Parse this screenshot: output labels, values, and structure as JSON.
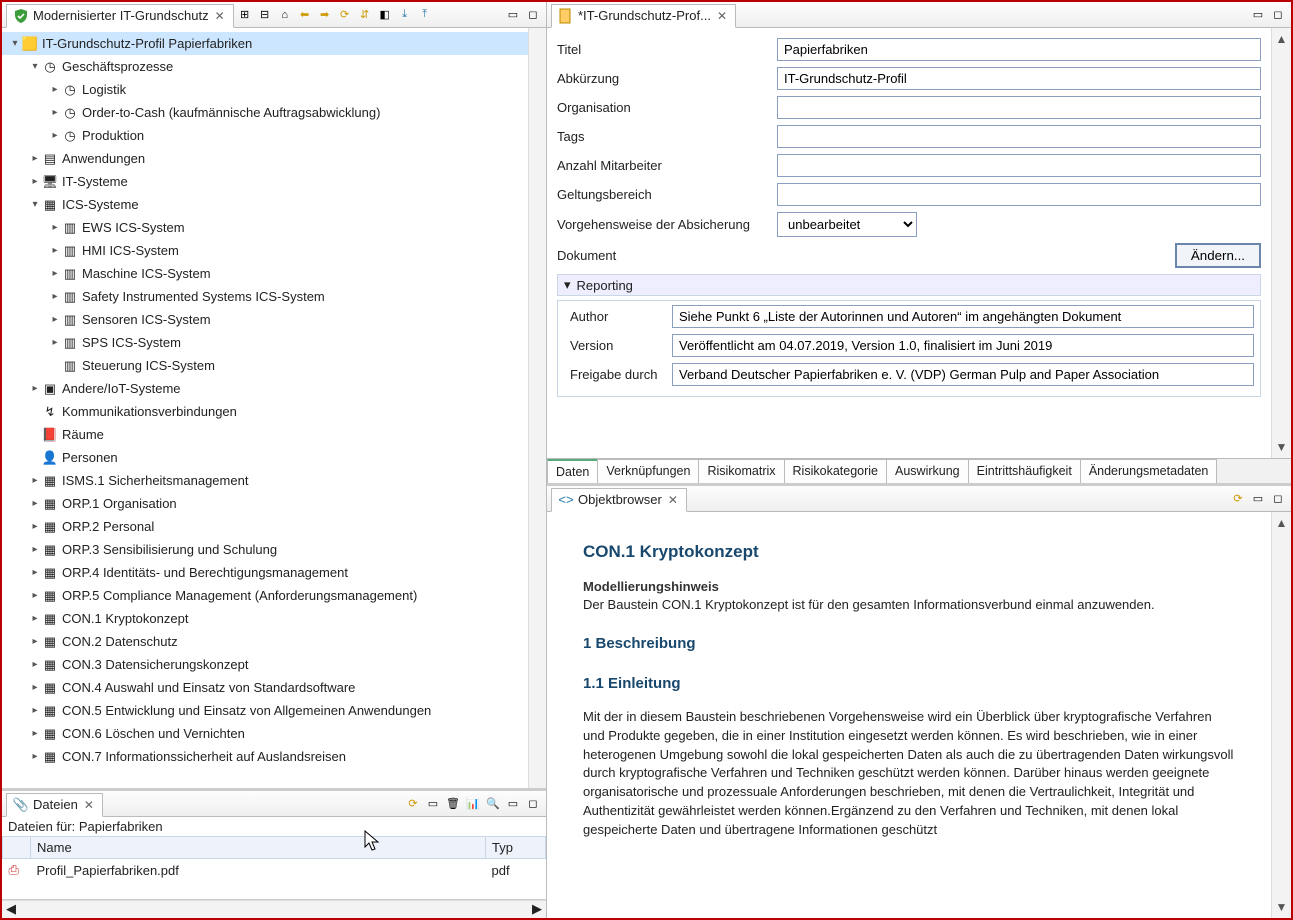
{
  "left_view": {
    "tab_title": "Modernisierter IT-Grundschutz",
    "toolbar_icons": [
      "expand-all",
      "collapse-all",
      "home",
      "back",
      "forward",
      "refresh",
      "link",
      "new",
      "import",
      "export"
    ]
  },
  "tree": {
    "root": "IT-Grundschutz-Profil  Papierfabriken",
    "items": [
      {
        "indent": 1,
        "exp": "down",
        "icon": "org",
        "label": "Geschäftsprozesse"
      },
      {
        "indent": 2,
        "exp": "right",
        "icon": "proc",
        "label": "Logistik"
      },
      {
        "indent": 2,
        "exp": "right",
        "icon": "proc",
        "label": "Order-to-Cash (kaufmännische Auftragsabwicklung)"
      },
      {
        "indent": 2,
        "exp": "right",
        "icon": "proc",
        "label": "Produktion"
      },
      {
        "indent": 1,
        "exp": "right",
        "icon": "app",
        "label": "Anwendungen"
      },
      {
        "indent": 1,
        "exp": "right",
        "icon": "pc",
        "label": "IT-Systeme"
      },
      {
        "indent": 1,
        "exp": "down",
        "icon": "ics",
        "label": "ICS-Systeme"
      },
      {
        "indent": 2,
        "exp": "right",
        "icon": "ics-node",
        "label": "EWS ICS-System"
      },
      {
        "indent": 2,
        "exp": "right",
        "icon": "ics-node",
        "label": "HMI ICS-System"
      },
      {
        "indent": 2,
        "exp": "right",
        "icon": "ics-node",
        "label": "Maschine ICS-System"
      },
      {
        "indent": 2,
        "exp": "right",
        "icon": "ics-node",
        "label": "Safety Instrumented Systems ICS-System"
      },
      {
        "indent": 2,
        "exp": "right",
        "icon": "ics-node",
        "label": "Sensoren ICS-System"
      },
      {
        "indent": 2,
        "exp": "right",
        "icon": "ics-node",
        "label": "SPS ICS-System"
      },
      {
        "indent": 2,
        "exp": "none",
        "icon": "ics-node",
        "label": "Steuerung ICS-System"
      },
      {
        "indent": 1,
        "exp": "right",
        "icon": "iot",
        "label": "Andere/IoT-Systeme"
      },
      {
        "indent": 1,
        "exp": "none",
        "icon": "link",
        "label": "Kommunikationsverbindungen"
      },
      {
        "indent": 1,
        "exp": "none",
        "icon": "room",
        "label": "Räume"
      },
      {
        "indent": 1,
        "exp": "none",
        "icon": "person",
        "label": "Personen"
      },
      {
        "indent": 1,
        "exp": "right",
        "icon": "module",
        "label": "ISMS.1 Sicherheitsmanagement"
      },
      {
        "indent": 1,
        "exp": "right",
        "icon": "module",
        "label": "ORP.1 Organisation"
      },
      {
        "indent": 1,
        "exp": "right",
        "icon": "module",
        "label": "ORP.2 Personal"
      },
      {
        "indent": 1,
        "exp": "right",
        "icon": "module",
        "label": "ORP.3 Sensibilisierung und Schulung"
      },
      {
        "indent": 1,
        "exp": "right",
        "icon": "module",
        "label": "ORP.4 Identitäts- und Berechtigungsmanagement"
      },
      {
        "indent": 1,
        "exp": "right",
        "icon": "module",
        "label": "ORP.5 Compliance Management (Anforderungsmanagement)"
      },
      {
        "indent": 1,
        "exp": "right",
        "icon": "module",
        "label": "CON.1 Kryptokonzept"
      },
      {
        "indent": 1,
        "exp": "right",
        "icon": "module",
        "label": "CON.2 Datenschutz"
      },
      {
        "indent": 1,
        "exp": "right",
        "icon": "module",
        "label": "CON.3 Datensicherungskonzept"
      },
      {
        "indent": 1,
        "exp": "right",
        "icon": "module",
        "label": "CON.4 Auswahl und Einsatz von Standardsoftware"
      },
      {
        "indent": 1,
        "exp": "right",
        "icon": "module",
        "label": "CON.5 Entwicklung und Einsatz von Allgemeinen Anwendungen"
      },
      {
        "indent": 1,
        "exp": "right",
        "icon": "module",
        "label": "CON.6 Löschen und Vernichten"
      },
      {
        "indent": 1,
        "exp": "right",
        "icon": "module",
        "label": "CON.7 Informationssicherheit auf Auslandsreisen"
      }
    ]
  },
  "files": {
    "tab_title": "Dateien",
    "header": "Dateien für: Papierfabriken",
    "cols": {
      "name": "Name",
      "type": "Typ"
    },
    "rows": [
      {
        "name": "Profil_Papierfabriken.pdf",
        "type": "pdf"
      }
    ]
  },
  "editor": {
    "tab_title": "*IT-Grundschutz-Prof...",
    "fields": {
      "title_label": "Titel",
      "title_value": "Papierfabriken",
      "abbrev_label": "Abkürzung",
      "abbrev_value": "IT-Grundschutz-Profil",
      "org_label": "Organisation",
      "org_value": "",
      "tags_label": "Tags",
      "tags_value": "",
      "emp_label": "Anzahl Mitarbeiter",
      "emp_value": "",
      "scope_label": "Geltungsbereich",
      "scope_value": "",
      "approach_label": "Vorgehensweise der Absicherung",
      "approach_value": "unbearbeitet",
      "doc_label": "Dokument",
      "change_btn": "Ändern...",
      "reporting": "Reporting",
      "author_label": "Author",
      "author_value": "Siehe Punkt 6 „Liste der Autorinnen und Autoren“ im angehängten Dokument",
      "version_label": "Version",
      "version_value": "Veröffentlicht am 04.07.2019, Version 1.0, finalisiert im Juni 2019",
      "release_label": "Freigabe durch",
      "release_value": "Verband Deutscher Papierfabriken e. V. (VDP) German Pulp and Paper Association"
    },
    "tabs": [
      "Daten",
      "Verknüpfungen",
      "Risikomatrix",
      "Risikokategorie",
      "Auswirkung",
      "Eintrittshäufigkeit",
      "Änderungsmetadaten"
    ]
  },
  "browser": {
    "tab_title": "Objektbrowser",
    "h2": "CON.1 Kryptokonzept",
    "hint_head": "Modellierungshinweis",
    "hint_body": "Der Baustein CON.1 Kryptokonzept ist für den gesamten Informationsverbund einmal anzuwenden.",
    "h3a": "1 Beschreibung",
    "h3b": "1.1 Einleitung",
    "body": "Mit der in diesem Baustein beschriebenen Vorgehensweise wird ein Überblick über kryptografische Verfahren und Produkte gegeben, die in einer Institution eingesetzt werden können. Es wird beschrieben, wie in einer heterogenen Umgebung sowohl die lokal gespeicherten Daten als auch die zu übertragenden Daten wirkungsvoll durch kryptografische Verfahren und Techniken geschützt werden können. Darüber hinaus werden geeignete organisatorische und prozessuale Anforderungen beschrieben, mit denen die Vertraulichkeit, Integrität und Authentizität gewährleistet werden können.Ergänzend zu den Verfahren und Techniken, mit denen lokal gespeicherte Daten und übertragene Informationen geschützt"
  }
}
